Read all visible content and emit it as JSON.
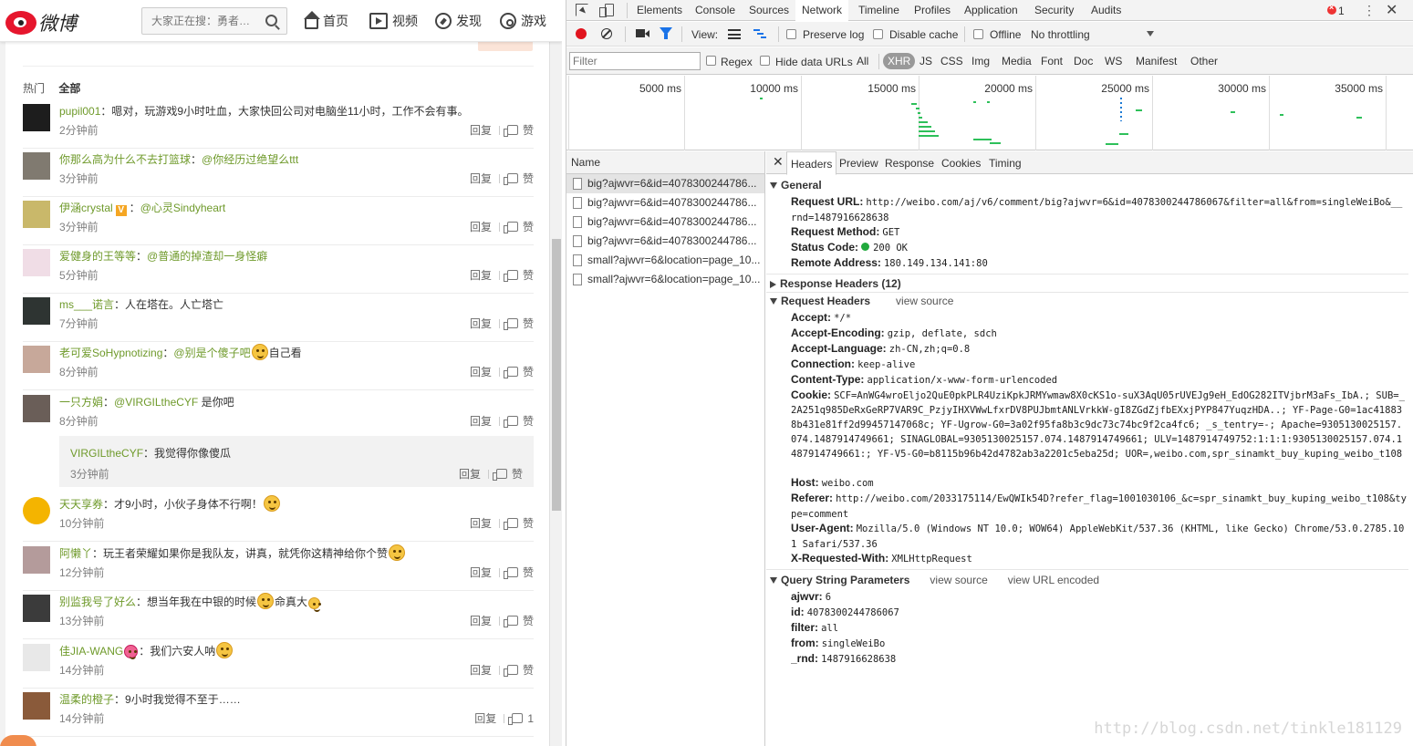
{
  "weibo": {
    "logo_text": "微博",
    "search_placeholder": "大家正在搜：勇者…",
    "nav": [
      {
        "label": "首页",
        "icon": "home-icon"
      },
      {
        "label": "视频",
        "icon": "video-icon"
      },
      {
        "label": "发现",
        "icon": "discover-icon"
      },
      {
        "label": "游戏",
        "icon": "game-icon"
      }
    ],
    "tabs": {
      "hot": "热门",
      "all": "全部"
    },
    "reply_label": "回复",
    "like_label": "赞",
    "comments": [
      {
        "user": "pupil001",
        "text": "：嗯对，玩游戏9小时吐血，大家快回公司对电脑坐11小时，工作不会有事。",
        "time": "2分钟前",
        "avatar": "#1d1d1d"
      },
      {
        "user": "你那么高为什么不去打篮球",
        "at": "@你经历过绝望么ttt",
        "text": "：",
        "time": "3分钟前",
        "avatar": "#807a70"
      },
      {
        "user": "伊涵crystal",
        "verified": true,
        "at": "@心灵Sindyheart",
        "text": "：",
        "time": "3分钟前",
        "avatar": "#c9b86a"
      },
      {
        "user": "爱健身的王等等",
        "at": "@普通的掉渣却一身怪癖",
        "text": "：",
        "time": "5分钟前",
        "avatar": "#f0dde6"
      },
      {
        "user": "ms___诺言",
        "text": "：人在塔在。人亡塔亡",
        "time": "7分钟前",
        "avatar": "#2e3432"
      },
      {
        "user": "老可爱SoHypnotizing",
        "at": "@别是个傻子吧",
        "text": "：",
        "after": "自己看",
        "emoji": true,
        "time": "8分钟前",
        "avatar": "#c7a89a"
      },
      {
        "user": "一只方娟",
        "at": "@VIRGILtheCYF",
        "text": "：",
        "after": " 是你吧",
        "time": "8分钟前",
        "avatar": "#6a5e58"
      },
      {
        "user": "天天享券",
        "text": "：才9小时，小伙子身体不行啊！",
        "emoji": true,
        "time": "10分钟前",
        "avatar": "#f4b400"
      },
      {
        "user": "阿懒丫",
        "text": "：玩王者荣耀如果你是我队友，讲真，就凭你这精神给你个赞",
        "emoji": true,
        "time": "12分钟前",
        "avatar": "#b49b9b"
      },
      {
        "user": "别监我号了好么",
        "text": "：想当年我在中银的时候",
        "emoji": true,
        "after": "命真大",
        "emoji2": true,
        "time": "13分钟前",
        "avatar": "#3b3b3b"
      },
      {
        "user": "佳JIA-WANG",
        "text": "：我们六安人呐",
        "emoji": true,
        "time": "14分钟前",
        "avatar": "#e8e8e8"
      },
      {
        "user": "温柔的橙子",
        "text": "：9小时我觉得不至于……",
        "time": "14分钟前",
        "avatar": "#8a5a3a",
        "like_count": "1"
      }
    ],
    "sub_reply": {
      "user": "VIRGILtheCYF",
      "text": "：我觉得你像傻瓜",
      "time": "3分钟前"
    }
  },
  "devtools": {
    "tabs": [
      "Elements",
      "Console",
      "Sources",
      "Network",
      "Timeline",
      "Profiles",
      "Application",
      "Security",
      "Audits"
    ],
    "active_tab": "Network",
    "error_count": "1",
    "toolbar": {
      "view_label": "View:",
      "preserve_log": "Preserve log",
      "disable_cache": "Disable cache",
      "offline": "Offline",
      "throttling": "No throttling"
    },
    "filter": {
      "placeholder": "Filter",
      "regex": "Regex",
      "hide_data_urls": "Hide data URLs",
      "types": [
        "All",
        "XHR",
        "JS",
        "CSS",
        "Img",
        "Media",
        "Font",
        "Doc",
        "WS",
        "Manifest",
        "Other"
      ],
      "active_type": "XHR"
    },
    "overview_ticks": [
      "5000 ms",
      "10000 ms",
      "15000 ms",
      "20000 ms",
      "25000 ms",
      "30000 ms",
      "35000 ms"
    ],
    "requests_header": "Name",
    "requests": [
      "big?ajwvr=6&id=4078300244786...",
      "big?ajwvr=6&id=4078300244786...",
      "big?ajwvr=6&id=4078300244786...",
      "big?ajwvr=6&id=4078300244786...",
      "small?ajwvr=6&location=page_10...",
      "small?ajwvr=6&location=page_10..."
    ],
    "detail_tabs": [
      "Headers",
      "Preview",
      "Response",
      "Cookies",
      "Timing"
    ],
    "general": {
      "title": "General",
      "request_url_label": "Request URL:",
      "request_url": "http://weibo.com/aj/v6/comment/big?ajwvr=6&id=4078300244786067&filter=all&from=singleWeiBo&__rnd=1487916628638",
      "method_label": "Request Method:",
      "method": "GET",
      "status_label": "Status Code:",
      "status": "200 OK",
      "remote_label": "Remote Address:",
      "remote": "180.149.134.141:80"
    },
    "response_headers_title": "Response Headers (12)",
    "request_headers_title": "Request Headers",
    "view_source": "view source",
    "view_url_encoded": "view URL encoded",
    "request_headers": [
      {
        "k": "Accept:",
        "v": "*/*"
      },
      {
        "k": "Accept-Encoding:",
        "v": "gzip, deflate, sdch"
      },
      {
        "k": "Accept-Language:",
        "v": "zh-CN,zh;q=0.8"
      },
      {
        "k": "Connection:",
        "v": "keep-alive"
      },
      {
        "k": "Content-Type:",
        "v": "application/x-www-form-urlencoded"
      },
      {
        "k": "Cookie:",
        "v": "SCF=AnWG4wroEljo2QuE0pkPLR4UziKpkJRMYwmaw8X0cKS1o-suX3AqU05rUVEJg9eH_EdOG282ITVjbrM3aFs_IbA.; SUB=_2A251q985DeRxGeRP7VAR9C_PzjyIHXVWwLfxrDV8PUJbmtANLVrkkW-gI8ZGdZjfbEXxjPYP847YuqzHDA..; YF-Page-G0=1ac418838b431e81ff2d99457147068c; YF-Ugrow-G0=3a02f95fa8b3c9dc73c74bc9f2ca4fc6; _s_tentry=-; Apache=9305130025157.074.1487914749661; SINAGLOBAL=9305130025157.074.1487914749661; ULV=1487914749752:1:1:1:9305130025157.074.1487914749661:; YF-V5-G0=b8115b96b42d4782ab3a2201c5eba25d; UOR=,weibo.com,spr_sinamkt_buy_kuping_weibo_t108"
      },
      {
        "k": "Host:",
        "v": "weibo.com"
      },
      {
        "k": "Referer:",
        "v": "http://weibo.com/2033175114/EwQWIk54D?refer_flag=1001030106_&c=spr_sinamkt_buy_kuping_weibo_t108&type=comment"
      },
      {
        "k": "User-Agent:",
        "v": "Mozilla/5.0 (Windows NT 10.0; WOW64) AppleWebKit/537.36 (KHTML, like Gecko) Chrome/53.0.2785.101 Safari/537.36"
      },
      {
        "k": "X-Requested-With:",
        "v": "XMLHttpRequest"
      }
    ],
    "query_title": "Query String Parameters",
    "query_params": [
      {
        "k": "ajwvr:",
        "v": "6"
      },
      {
        "k": "id:",
        "v": "4078300244786067"
      },
      {
        "k": "filter:",
        "v": "all"
      },
      {
        "k": "from:",
        "v": "singleWeiBo"
      },
      {
        "k": "_rnd:",
        "v": "1487916628638"
      }
    ]
  },
  "watermark": "http://blog.csdn.net/tinkle181129"
}
